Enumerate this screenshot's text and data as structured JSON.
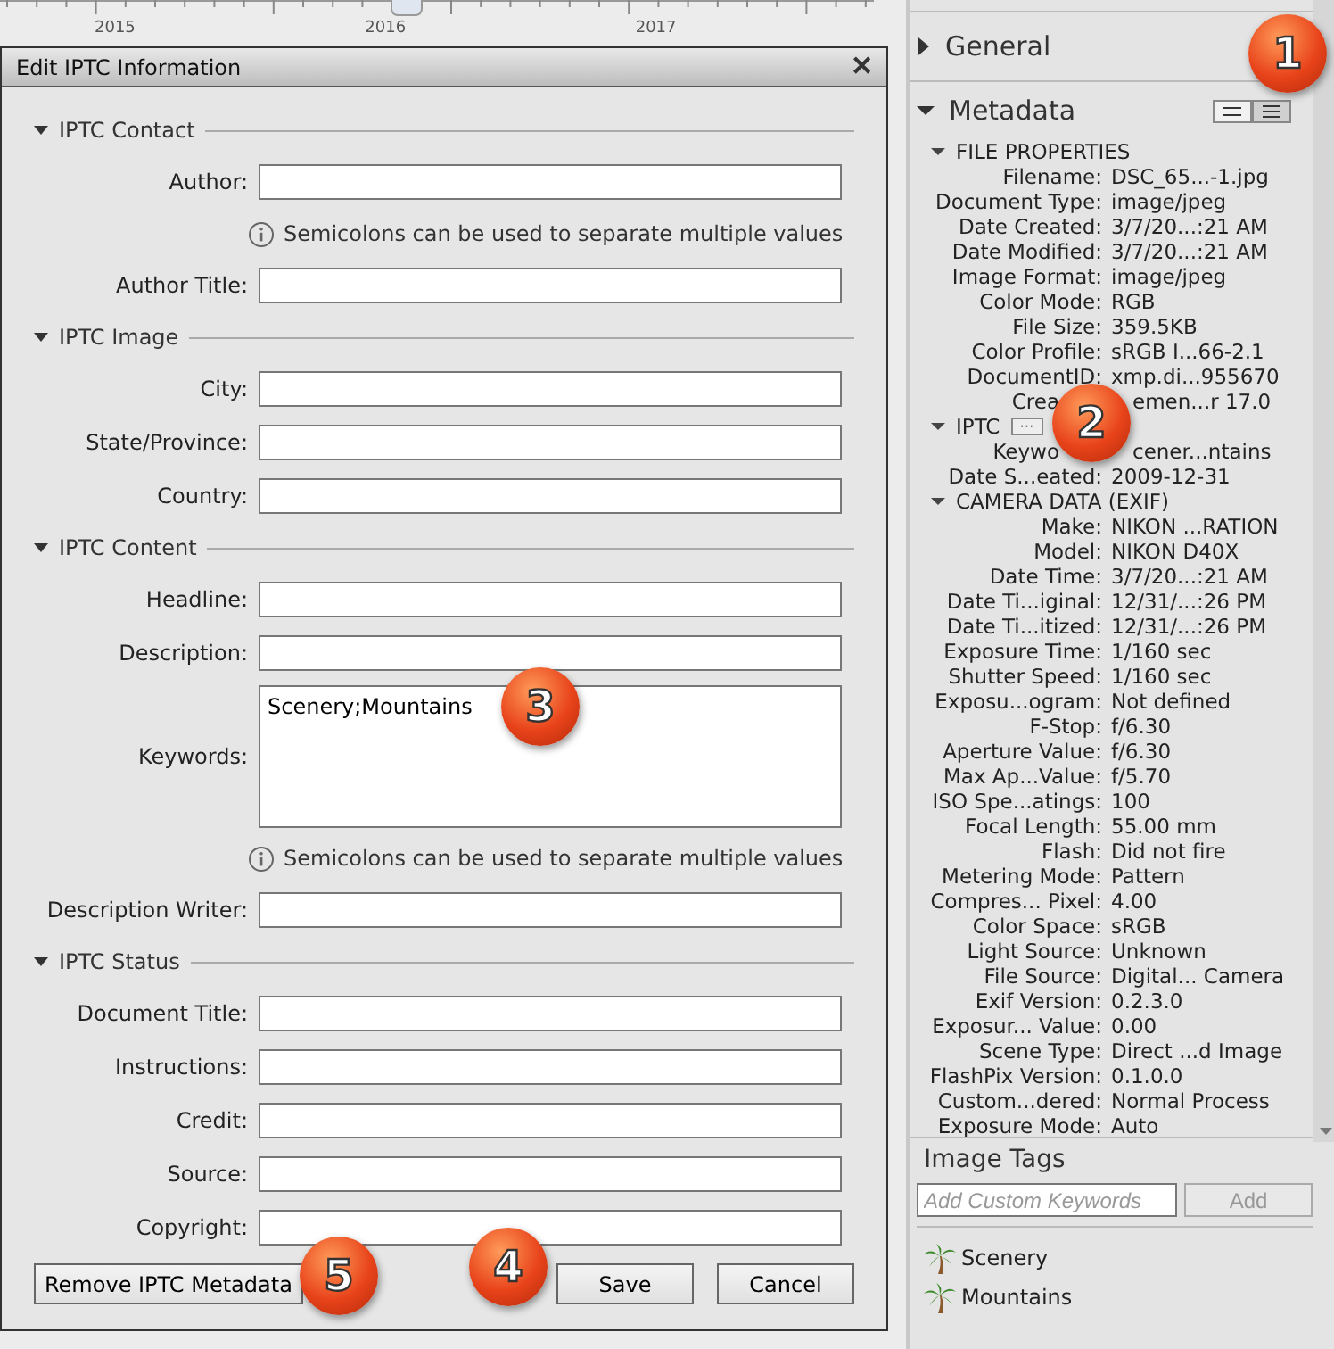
{
  "timeline": {
    "years": [
      "2015",
      "2016",
      "2017"
    ]
  },
  "dialog": {
    "title": "Edit IPTC Information",
    "close": "✕",
    "sections": [
      {
        "title": "IPTC Contact",
        "expanded": true,
        "items": [
          {
            "kind": "field",
            "label": "Author:"
          },
          {
            "kind": "note",
            "text": "Semicolons can be used to separate multiple values"
          },
          {
            "kind": "field",
            "label": "Author Title:"
          }
        ]
      },
      {
        "title": "IPTC Image",
        "expanded": true,
        "items": [
          {
            "kind": "field",
            "label": "City:"
          },
          {
            "kind": "field",
            "label": "State/Province:"
          },
          {
            "kind": "field",
            "label": "Country:"
          }
        ]
      },
      {
        "title": "IPTC Content",
        "expanded": true,
        "items": [
          {
            "kind": "field",
            "label": "Headline:"
          },
          {
            "kind": "field",
            "label": "Description:"
          },
          {
            "kind": "textarea",
            "label": "Keywords:",
            "value": "Scenery;Mountains"
          },
          {
            "kind": "note",
            "text": "Semicolons can be used to separate multiple values"
          },
          {
            "kind": "field",
            "label": "Description Writer:"
          }
        ]
      },
      {
        "title": "IPTC Status",
        "expanded": true,
        "items": [
          {
            "kind": "field",
            "label": "Document Title:"
          },
          {
            "kind": "field",
            "label": "Instructions:"
          },
          {
            "kind": "field",
            "label": "Credit:"
          },
          {
            "kind": "field",
            "label": "Source:"
          },
          {
            "kind": "field",
            "label": "Copyright:"
          }
        ]
      }
    ],
    "buttons": [
      {
        "label": "Remove IPTC Metadata",
        "kind": "left"
      },
      {
        "label": "Save",
        "kind": "right"
      },
      {
        "label": "Cancel",
        "kind": "right"
      }
    ]
  },
  "panel": {
    "general": {
      "title": "General",
      "expanded": false
    },
    "metadata": {
      "title": "Metadata",
      "expanded": true,
      "groups": [
        {
          "title": "FILE PROPERTIES",
          "expanded": true,
          "rows": [
            {
              "label": "Filename:",
              "value": "DSC_65...-1.jpg"
            },
            {
              "label": "Document Type:",
              "value": "image/jpeg"
            },
            {
              "label": "Date Created:",
              "value": "3/7/20...:21 AM"
            },
            {
              "label": "Date Modified:",
              "value": "3/7/20...:21 AM"
            },
            {
              "label": "Image Format:",
              "value": "image/jpeg"
            },
            {
              "label": "Color Mode:",
              "value": "RGB"
            },
            {
              "label": "File Size:",
              "value": "359.5KB"
            },
            {
              "label": "Color Profile:",
              "value": "sRGB I...66-2.1"
            },
            {
              "label": "DocumentID:",
              "value": "xmp.di...955670"
            },
            {
              "label": "Crea",
              "value": "emen...r 17.0",
              "kind": "covered"
            }
          ]
        },
        {
          "title": "IPTC",
          "expanded": true,
          "more": "···",
          "rows": [
            {
              "label": "Keywo",
              "value": "cener...ntains",
              "kind": "covered"
            },
            {
              "label": "Date S...eated:",
              "value": "2009-12-31"
            }
          ]
        },
        {
          "title": "CAMERA DATA (EXIF)",
          "expanded": true,
          "rows": [
            {
              "label": "Make:",
              "value": "NIKON ...RATION"
            },
            {
              "label": "Model:",
              "value": "NIKON D40X"
            },
            {
              "label": "Date Time:",
              "value": "3/7/20...:21 AM"
            },
            {
              "label": "Date Ti...iginal:",
              "value": "12/31/...:26 PM"
            },
            {
              "label": "Date Ti...itized:",
              "value": "12/31/...:26 PM"
            },
            {
              "label": "Exposure Time:",
              "value": "1/160 sec"
            },
            {
              "label": "Shutter Speed:",
              "value": "1/160 sec"
            },
            {
              "label": "Exposu...ogram:",
              "value": "Not defined"
            },
            {
              "label": "F-Stop:",
              "value": "f/6.30"
            },
            {
              "label": "Aperture Value:",
              "value": "f/6.30"
            },
            {
              "label": "Max Ap...Value:",
              "value": "f/5.70"
            },
            {
              "label": "ISO Spe...atings:",
              "value": "100"
            },
            {
              "label": "Focal Length:",
              "value": "55.00 mm"
            },
            {
              "label": "Flash:",
              "value": "Did not fire"
            },
            {
              "label": "Metering Mode:",
              "value": "Pattern"
            },
            {
              "label": "Compres... Pixel:",
              "value": "4.00"
            },
            {
              "label": "Color Space:",
              "value": "sRGB"
            },
            {
              "label": "Light Source:",
              "value": "Unknown"
            },
            {
              "label": "File Source:",
              "value": "Digital... Camera"
            },
            {
              "label": "Exif Version:",
              "value": "0.2.3.0"
            },
            {
              "label": "Exposur... Value:",
              "value": "0.00"
            },
            {
              "label": "Scene Type:",
              "value": "Direct ...d Image"
            },
            {
              "label": "FlashPix Version:",
              "value": "0.1.0.0"
            },
            {
              "label": "Custom...dered:",
              "value": "Normal Process"
            },
            {
              "label": "Exposure Mode:",
              "value": "Auto"
            }
          ]
        }
      ]
    },
    "image_tags": {
      "title": "Image Tags",
      "placeholder": "Add Custom Keywords",
      "add_button": {
        "label": "Add",
        "disabled": true
      },
      "tags": [
        "Scenery",
        "Mountains"
      ]
    }
  },
  "callouts": [
    "1",
    "2",
    "3",
    "4",
    "5"
  ]
}
